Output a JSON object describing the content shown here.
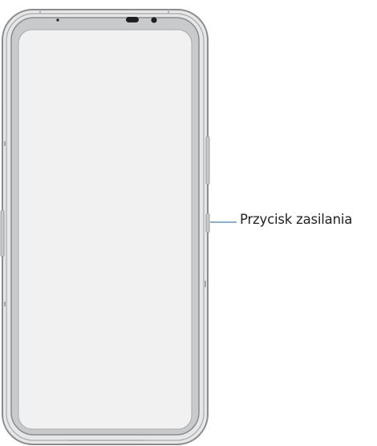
{
  "diagram": {
    "subject": "phone-front-view",
    "callouts": [
      {
        "id": "power-button",
        "label": "Przycisk zasilania"
      }
    ]
  },
  "colors": {
    "outline": "#8c8c8c",
    "frame": "#e6e7e8",
    "bezel": "#c9cacc",
    "screen": "#f1f1f2",
    "callout_line": "#1f5f8b",
    "text": "#231f20"
  }
}
